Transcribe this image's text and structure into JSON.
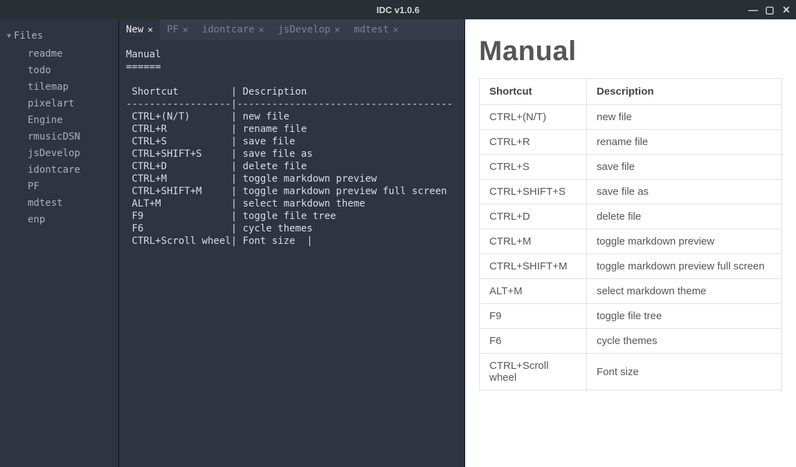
{
  "window": {
    "title": "IDC v1.0.6"
  },
  "sidebar": {
    "header": "Files",
    "items": [
      "readme",
      "todo",
      "tilemap",
      "pixelart",
      "Engine",
      "rmusicDSN",
      "jsDevelop",
      "idontcare",
      "PF",
      "mdtest",
      "enp"
    ]
  },
  "tabs": [
    {
      "label": "New",
      "active": true
    },
    {
      "label": "PF",
      "active": false
    },
    {
      "label": "idontcare",
      "active": false
    },
    {
      "label": "jsDevelop",
      "active": false
    },
    {
      "label": "mdtest",
      "active": false
    }
  ],
  "editor": {
    "title": "Manual",
    "underline": "======",
    "header_shortcut": "Shortcut",
    "header_desc": "Description",
    "rows": [
      {
        "s": "CTRL+(N/T)",
        "d": "new file"
      },
      {
        "s": "CTRL+R",
        "d": "rename file"
      },
      {
        "s": "CTRL+S",
        "d": "save file"
      },
      {
        "s": "CTRL+SHIFT+S",
        "d": "save file as"
      },
      {
        "s": "CTRL+D",
        "d": "delete file"
      },
      {
        "s": "CTRL+M",
        "d": "toggle markdown preview"
      },
      {
        "s": "CTRL+SHIFT+M",
        "d": "toggle markdown preview full screen"
      },
      {
        "s": "ALT+M",
        "d": "select markdown theme"
      },
      {
        "s": "F9",
        "d": "toggle file tree"
      },
      {
        "s": "F6",
        "d": "cycle themes"
      },
      {
        "s": "CTRL+Scroll wheel",
        "d": "Font size  |"
      }
    ]
  },
  "preview": {
    "heading": "Manual",
    "header_shortcut": "Shortcut",
    "header_desc": "Description",
    "rows": [
      {
        "s": "CTRL+(N/T)",
        "d": "new file"
      },
      {
        "s": "CTRL+R",
        "d": "rename file"
      },
      {
        "s": "CTRL+S",
        "d": "save file"
      },
      {
        "s": "CTRL+SHIFT+S",
        "d": "save file as"
      },
      {
        "s": "CTRL+D",
        "d": "delete file"
      },
      {
        "s": "CTRL+M",
        "d": "toggle markdown preview"
      },
      {
        "s": "CTRL+SHIFT+M",
        "d": "toggle markdown preview full screen"
      },
      {
        "s": "ALT+M",
        "d": "select markdown theme"
      },
      {
        "s": "F9",
        "d": "toggle file tree"
      },
      {
        "s": "F6",
        "d": "cycle themes"
      },
      {
        "s": "CTRL+Scroll wheel",
        "d": "Font size"
      }
    ]
  }
}
